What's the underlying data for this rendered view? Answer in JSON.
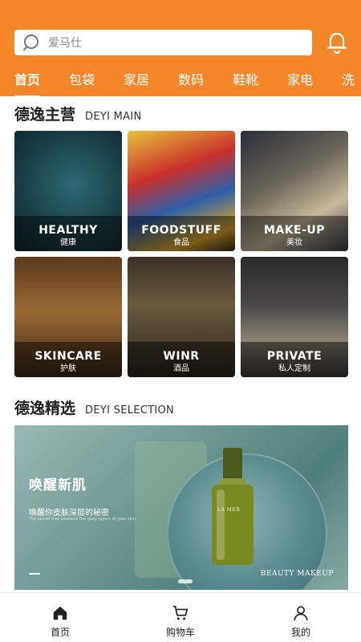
{
  "search": {
    "placeholder": "爱马仕"
  },
  "tabs": [
    {
      "label": "首页"
    },
    {
      "label": "包袋"
    },
    {
      "label": "家居"
    },
    {
      "label": "数码"
    },
    {
      "label": "鞋靴"
    },
    {
      "label": "家电"
    },
    {
      "label": "洗"
    }
  ],
  "main_section": {
    "title_cn": "德逸主营",
    "title_en": "DEYI MAIN"
  },
  "main_tiles": [
    {
      "en": "HEALTHY",
      "cn": "健康"
    },
    {
      "en": "FOODSTUFF",
      "cn": "食品"
    },
    {
      "en": "MAKE-UP",
      "cn": "美妆"
    },
    {
      "en": "SKINCARE",
      "cn": "护肤"
    },
    {
      "en": "WINR",
      "cn": "酒品"
    },
    {
      "en": "PRIVATE",
      "cn": "私人定制"
    }
  ],
  "selection_section": {
    "title_cn": "德逸精选",
    "title_en": "DEYI SELECTION"
  },
  "banner": {
    "title": "唤醒新肌",
    "subtitle": "唤醒你皮肤深层的秘密",
    "tiny_text": "The secret that awakens the deep layers of your skin",
    "product_brand": "LA MER",
    "brand_tag": "BEAUTY MAKEUP"
  },
  "bottom_nav": [
    {
      "label": "首页",
      "icon": "home-icon"
    },
    {
      "label": "购物车",
      "icon": "cart-icon"
    },
    {
      "label": "我的",
      "icon": "user-icon"
    }
  ],
  "colors": {
    "accent": "#f5862a"
  }
}
